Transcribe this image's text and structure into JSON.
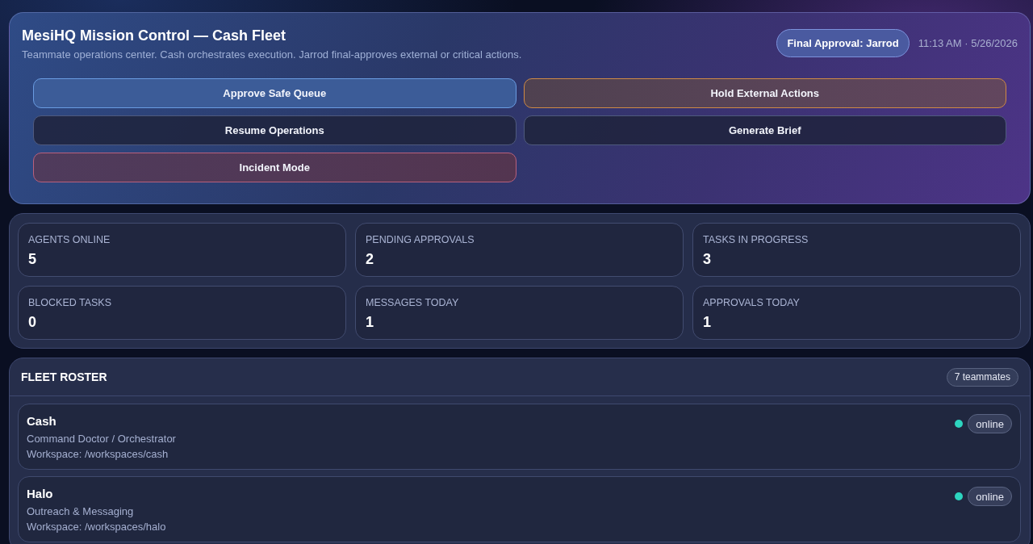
{
  "header": {
    "title": "MesiHQ Mission Control — Cash Fleet",
    "subtitle": "Teammate operations center. Cash orchestrates execution. Jarrod final-approves external or critical actions.",
    "approval_badge": "Final Approval: Jarrod",
    "timestamp": "11:13 AM · 5/26/2026"
  },
  "actions": [
    {
      "label": "Approve Safe Queue",
      "kind": "primary"
    },
    {
      "label": "Hold External Actions",
      "kind": "warning"
    },
    {
      "label": "Resume Operations",
      "kind": "neutral"
    },
    {
      "label": "Generate Brief",
      "kind": "neutral"
    },
    {
      "label": "Incident Mode",
      "kind": "danger"
    }
  ],
  "stats": [
    {
      "label": "AGENTS ONLINE",
      "value": "5"
    },
    {
      "label": "PENDING APPROVALS",
      "value": "2"
    },
    {
      "label": "TASKS IN PROGRESS",
      "value": "3"
    },
    {
      "label": "BLOCKED TASKS",
      "value": "0"
    },
    {
      "label": "MESSAGES TODAY",
      "value": "1"
    },
    {
      "label": "APPROVALS TODAY",
      "value": "1"
    }
  ],
  "roster": {
    "title": "FLEET ROSTER",
    "count": "7 teammates",
    "members": [
      {
        "name": "Cash",
        "role": "Command Doctor / Orchestrator",
        "workspace": "Workspace: /workspaces/cash",
        "status": "online",
        "color": "#2dd4bf"
      },
      {
        "name": "Halo",
        "role": "Outreach & Messaging",
        "workspace": "Workspace: /workspaces/halo",
        "status": "online",
        "color": "#2dd4bf"
      }
    ]
  }
}
